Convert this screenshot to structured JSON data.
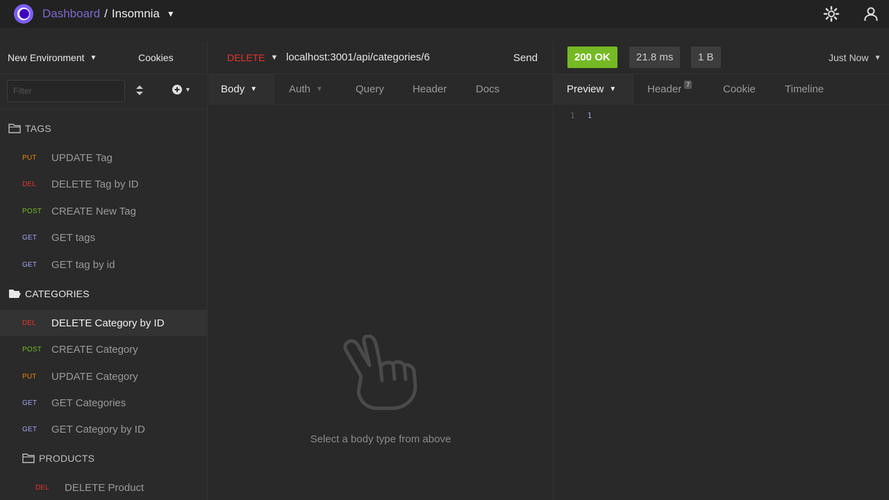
{
  "header": {
    "dashboard_label": "Dashboard",
    "separator": "/",
    "project_name": "Insomnia",
    "icons": [
      "settings-gear-icon",
      "account-icon"
    ]
  },
  "sidebar": {
    "environment_label": "New Environment",
    "cookies_label": "Cookies",
    "filter_placeholder": "Filter",
    "folders": [
      {
        "name": "TAGS",
        "requests": [
          {
            "method": "PUT",
            "name": "UPDATE Tag"
          },
          {
            "method": "DEL",
            "name": "DELETE Tag by ID"
          },
          {
            "method": "POST",
            "name": "CREATE New Tag"
          },
          {
            "method": "GET",
            "name": "GET tags"
          },
          {
            "method": "GET",
            "name": "GET tag by id"
          }
        ]
      },
      {
        "name": "CATEGORIES",
        "requests": [
          {
            "method": "DEL",
            "name": "DELETE Category by ID"
          },
          {
            "method": "POST",
            "name": "CREATE Category"
          },
          {
            "method": "PUT",
            "name": "UPDATE Category"
          },
          {
            "method": "GET",
            "name": "GET Categories"
          },
          {
            "method": "GET",
            "name": "GET Category by ID"
          }
        ]
      },
      {
        "name": "PRODUCTS",
        "requests": [
          {
            "method": "DEL",
            "name": "DELETE Product"
          }
        ]
      }
    ]
  },
  "request": {
    "method": "DELETE",
    "url": "localhost:3001/api/categories/6",
    "send_label": "Send",
    "tabs": [
      "Body",
      "Auth",
      "Query",
      "Header",
      "Docs"
    ],
    "empty_message": "Select a body type from above"
  },
  "response": {
    "status": "200 OK",
    "time": "21.8 ms",
    "size": "1 B",
    "when": "Just Now",
    "tabs": [
      "Preview",
      "Header",
      "Cookie",
      "Timeline"
    ],
    "header_count": "7",
    "body_line_number": "1",
    "body_value": "1"
  },
  "colors": {
    "accent": "#7d5fff",
    "status_ok": "#75ba24",
    "put": "#ec8702",
    "del": "#e5342e",
    "post": "#75ba24",
    "get": "#a3a2f0"
  }
}
